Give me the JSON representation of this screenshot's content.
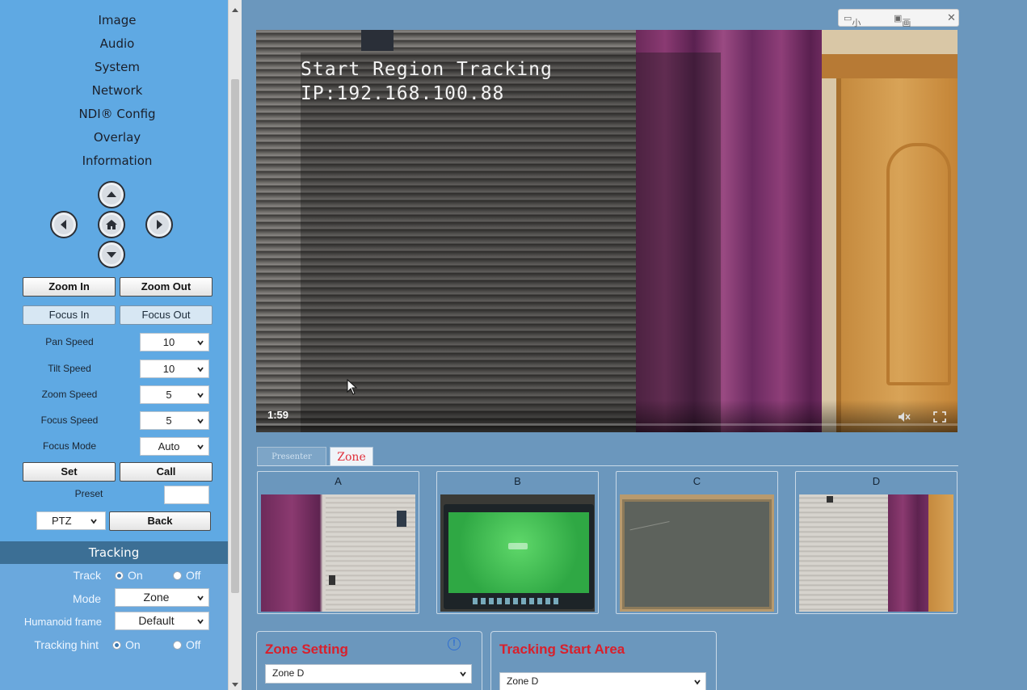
{
  "sidebar": {
    "menu": [
      "Image",
      "Audio",
      "System",
      "Network",
      "NDI® Config",
      "Overlay",
      "Information"
    ],
    "buttons": {
      "zoom_in": "Zoom In",
      "zoom_out": "Zoom Out",
      "focus_in": "Focus In",
      "focus_out": "Focus Out",
      "set": "Set",
      "call": "Call",
      "back": "Back"
    },
    "speeds": [
      {
        "label": "Pan Speed",
        "value": "10"
      },
      {
        "label": "Tilt Speed",
        "value": "10"
      },
      {
        "label": "Zoom Speed",
        "value": "5"
      },
      {
        "label": "Focus Speed",
        "value": "5"
      },
      {
        "label": "Focus Mode",
        "value": "Auto"
      }
    ],
    "preset_label": "Preset",
    "preset_value": "",
    "ptz_value": "PTZ",
    "tracking": {
      "title": "Tracking",
      "track_label": "Track",
      "on": "On",
      "off": "Off",
      "mode_label": "Mode",
      "mode_value": "Zone",
      "humanoid_label": "Humanoid frame",
      "humanoid_value": "Default",
      "hint_label": "Tracking hint"
    }
  },
  "video": {
    "overlay_line1": "Start Region Tracking",
    "overlay_line2": "IP:192.168.100.88",
    "time": "1:59"
  },
  "pip_bar": {
    "small_window": "小窗口",
    "pip": "画中画",
    "close": "✕"
  },
  "tabs": {
    "presenter": "Presenter",
    "zone": "Zone"
  },
  "zones": [
    {
      "label": "A"
    },
    {
      "label": "B"
    },
    {
      "label": "C"
    },
    {
      "label": "D"
    }
  ],
  "zone_setting": {
    "title": "Zone Setting",
    "value": "Zone D"
  },
  "tracking_start": {
    "title": "Tracking Start Area",
    "value": "Zone D"
  },
  "colors": {
    "sidebar_bg": "#5fa9e3",
    "main_bg": "#6b97bd",
    "tracking_header": "#3c6f95",
    "accent_red": "#d8202c"
  }
}
